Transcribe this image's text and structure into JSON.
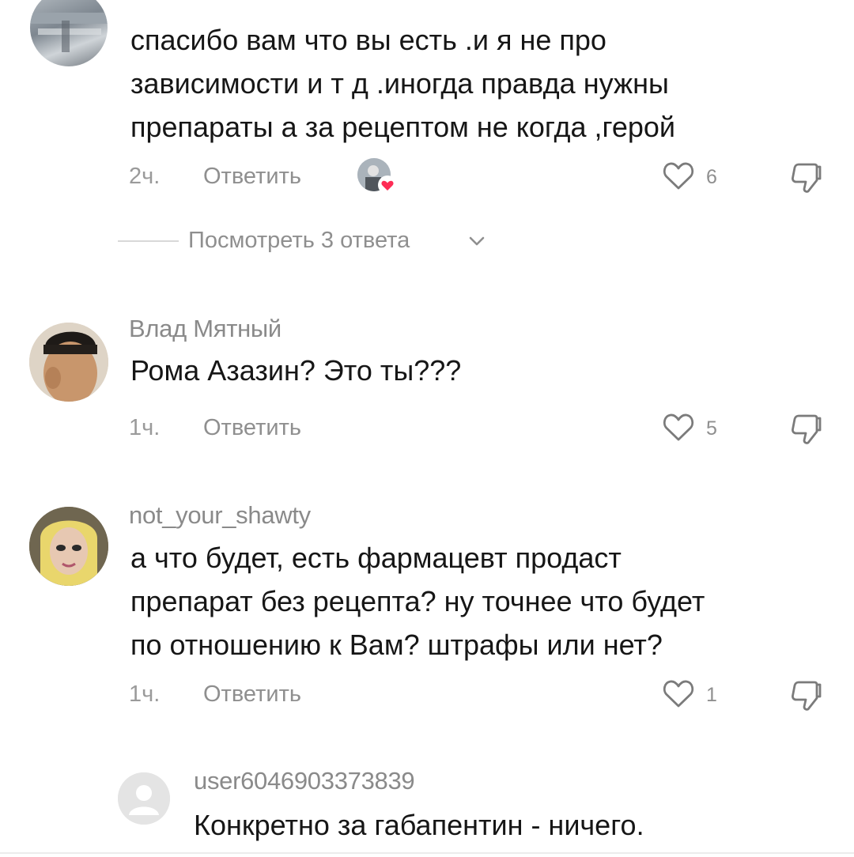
{
  "comments": [
    {
      "text_lines": [
        "спасибо вам что вы есть .и я не про",
        "зависимости и т д .иногда правда нужны",
        "препараты а за рецептом не когда ,герой"
      ],
      "time": "2ч.",
      "reply_label": "Ответить",
      "likes": "6",
      "creator_liked": true,
      "view_replies": "Посмотреть 3 ответа"
    },
    {
      "username": "Влад Мятный",
      "text_lines": [
        "Рома Азазин? Это ты???"
      ],
      "time": "1ч.",
      "reply_label": "Ответить",
      "likes": "5"
    },
    {
      "username": "not_your_shawty",
      "text_lines": [
        "а что будет, есть фармацевт продаст",
        "препарат без рецепта? ну точнее что будет",
        "по отношению к Вам? штрафы или нет?"
      ],
      "time": "1ч.",
      "reply_label": "Ответить",
      "likes": "1"
    }
  ],
  "reply": {
    "username": "user6046903373839",
    "text": "Конкретно за габапентин - ничего."
  },
  "colors": {
    "text": "#161616",
    "muted": "#8f8f8f",
    "heart_badge": "#fe2c55"
  },
  "icons": [
    "heart-outline-icon",
    "dislike-icon",
    "chevron-down-icon",
    "default-avatar-icon"
  ]
}
